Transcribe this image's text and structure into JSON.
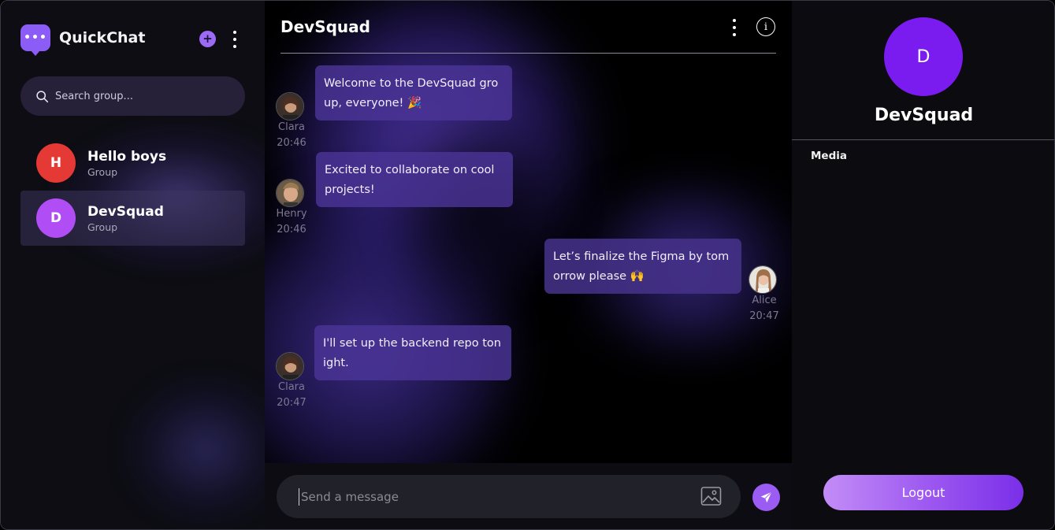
{
  "app": {
    "name": "QuickChat",
    "logo_glyph": "•••"
  },
  "sidebar": {
    "add_glyph": "+",
    "search": {
      "placeholder": "Search group..."
    },
    "groups": [
      {
        "initial": "H",
        "name": "Hello boys",
        "subtitle": "Group",
        "color": "#e53935",
        "active": false
      },
      {
        "initial": "D",
        "name": "DevSquad",
        "subtitle": "Group",
        "color": "#b14df5",
        "active": true
      }
    ]
  },
  "chat": {
    "title": "DevSquad",
    "info_glyph": "i",
    "messages": [
      {
        "text": "Welcome to the DevSquad group, everyone! 🎉",
        "sender": "Clara",
        "time": "20:46",
        "side": "left"
      },
      {
        "text": "Excited to collaborate on cool projects!",
        "sender": "Henry",
        "time": "20:46",
        "side": "left"
      },
      {
        "text": "Let’s finalize the Figma by tomorrow please 🙌",
        "sender": "Alice",
        "time": "20:47",
        "side": "right"
      },
      {
        "text": "I'll set up the backend repo tonight.",
        "sender": "Clara",
        "time": "20:47",
        "side": "left"
      }
    ],
    "composer": {
      "placeholder": "Send a message"
    }
  },
  "details": {
    "initial": "D",
    "name": "DevSquad",
    "media_label": "Media",
    "logout_label": "Logout"
  },
  "colors": {
    "accent": "#8b5cf6",
    "details_avatar": "#7a1cf0",
    "bubble": "#4a3496"
  }
}
